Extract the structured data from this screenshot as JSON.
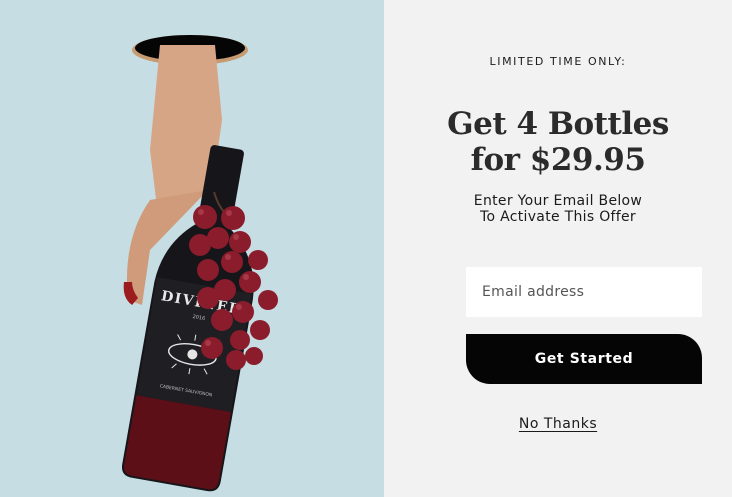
{
  "promo_image": {
    "label_text": "DIVINER",
    "label_year": "2016",
    "varietal_text": "CABERNET SAUVIGNON",
    "colors": {
      "background": "#c6dde4",
      "bottle": "#16161a",
      "wine": "#5c0f16",
      "grapes": "#8a1c2c",
      "skin": "#d6a585",
      "nail": "#9c1b1f"
    }
  },
  "offer": {
    "kicker": "LIMITED TIME ONLY:",
    "headline_line1": "Get 4 Bottles",
    "headline_line2": "for $29.95",
    "subhead_line1": "Enter Your Email Below",
    "subhead_line2": "To Activate This Offer"
  },
  "form": {
    "email_placeholder": "Email address",
    "submit_label": "Get Started",
    "dismiss_label": "No Thanks"
  }
}
